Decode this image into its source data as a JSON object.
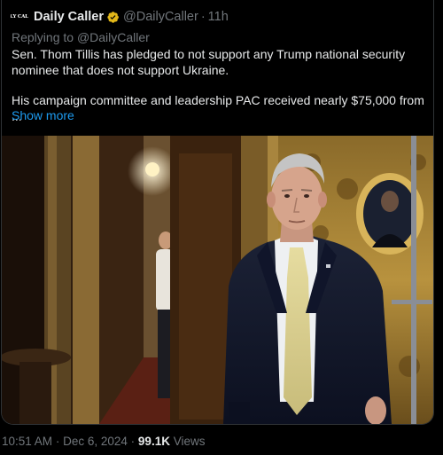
{
  "tweet": {
    "author": {
      "avatar_text": "DAILY CALLER",
      "name": "Daily Caller",
      "handle": "@DailyCaller",
      "separator": "·",
      "time": "11h",
      "verified_badge_icon": "gold-verified-badge-icon",
      "badge_color": "#e2b719"
    },
    "replying_prefix": "Replying to",
    "replying_handle": "@DailyCaller",
    "text_paragraph_1": "Sen. Thom Tillis has pledged to not support any Trump national security nominee that does not support Ukraine.",
    "text_paragraph_2": "His campaign committee and leadership PAC received nearly $75,000 from ...",
    "show_more": "Show more",
    "posted_time": "10:51 AM",
    "meta_separator": "·",
    "posted_date": "Dec 6, 2024",
    "meta_separator_2": "·",
    "views_count": "99.1K",
    "views_label": "Views"
  },
  "colors": {
    "background": "#000000",
    "text": "#e7e9ea",
    "muted": "#71767b",
    "link": "#1d9bf0",
    "border": "#2f3336"
  }
}
